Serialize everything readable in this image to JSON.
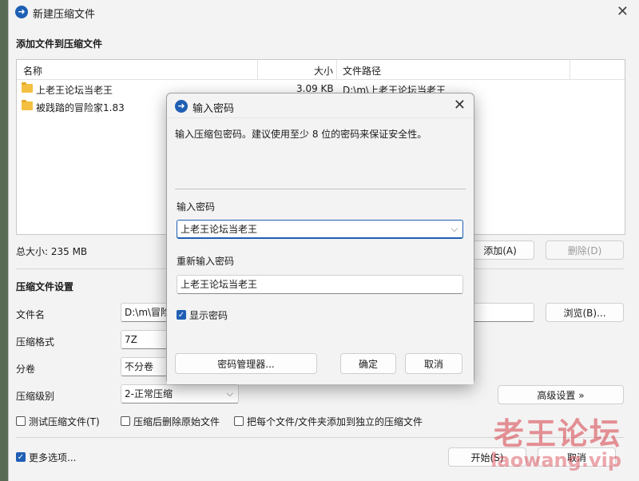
{
  "window": {
    "title": "新建压缩文件",
    "close_glyph": "✕",
    "section_add": "添加文件到压缩文件",
    "section_settings": "压缩文件设置"
  },
  "filelist": {
    "columns": {
      "name": "名称",
      "size": "大小",
      "path": "文件路径"
    },
    "rows": [
      {
        "name": "上老王论坛当老王",
        "size": "3.09 KB",
        "path": "D:\\m\\上老王论坛当老王"
      },
      {
        "name": "被践踏的冒险家1.83",
        "size": "",
        "path": ""
      }
    ]
  },
  "summary": {
    "total_size": "总大小: 235 MB"
  },
  "buttons": {
    "add": "添加(A)",
    "delete": "删除(D)",
    "browse": "浏览(B)...",
    "advanced": "高级设置 »",
    "start": "开始(S)",
    "cancel": "取消"
  },
  "settings": {
    "filename_label": "文件名",
    "filename_value": "D:\\m\\冒险",
    "format_label": "压缩格式",
    "format_value": "7Z",
    "volume_label": "分卷",
    "volume_value": "不分卷",
    "level_label": "压缩级别",
    "level_value": "2-正常压缩"
  },
  "options": {
    "test": "测试压缩文件(T)",
    "delete_source": "压缩后删除原始文件",
    "each_separate": "把每个文件/文件夹添加到独立的压缩文件",
    "more": "更多选项..."
  },
  "dialog": {
    "title": "输入密码",
    "description": "输入压缩包密码。建议使用至少 8 位的密码来保证安全性。",
    "password_label": "输入密码",
    "password_value": "上老王论坛当老王",
    "confirm_label": "重新输入密码",
    "confirm_value": "上老王论坛当老王",
    "show_password": "显示密码",
    "manager_button": "密码管理器...",
    "ok_button": "确定",
    "cancel_button": "取消"
  },
  "watermark": {
    "line1": "老王论坛",
    "line2": "laowang.vip"
  },
  "colors": {
    "accent": "#1e5fb4",
    "folder": "#f4c042"
  }
}
